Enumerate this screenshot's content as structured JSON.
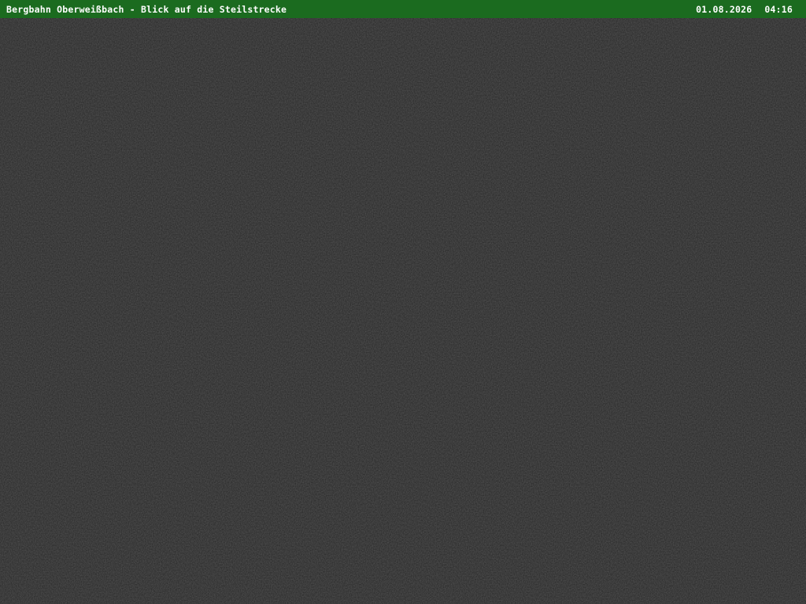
{
  "overlay": {
    "title": "Bergbahn Oberweißbach - Blick auf die Steilstrecke",
    "date": "01.08.2026",
    "time": "04:16"
  },
  "colors": {
    "overlay_background": "#1b6b1f",
    "overlay_text": "#ffffff",
    "image_background": "#262626",
    "image_noise": "#303030"
  }
}
